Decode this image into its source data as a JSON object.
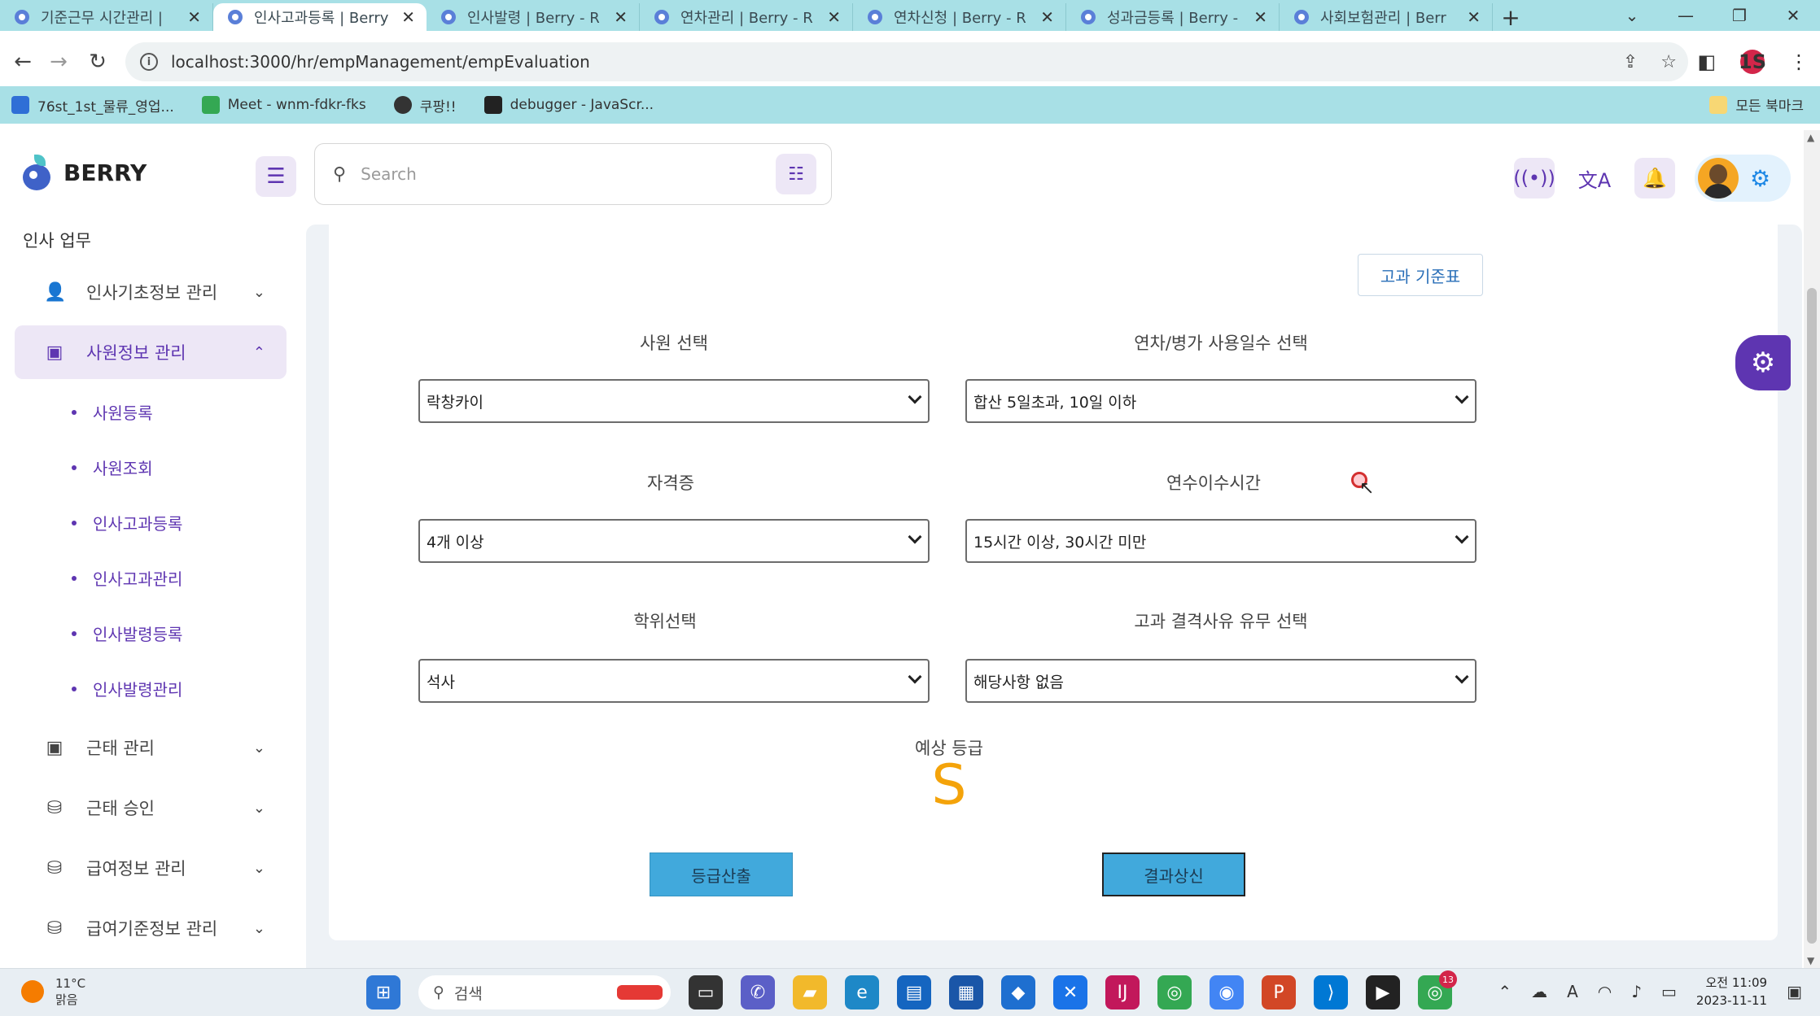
{
  "browser": {
    "tabs": [
      {
        "label": "기준근무 시간관리 |",
        "active": false
      },
      {
        "label": "인사고과등록 | Berry",
        "active": true
      },
      {
        "label": "인사발령 | Berry - R",
        "active": false
      },
      {
        "label": "연차관리 | Berry - R",
        "active": false
      },
      {
        "label": "연차신청 | Berry - R",
        "active": false
      },
      {
        "label": "성과금등록 | Berry -",
        "active": false
      },
      {
        "label": "사회보험관리 | Berr",
        "active": false
      }
    ],
    "url": "localhost:3000/hr/empManagement/empEvaluation",
    "profile_badge": "1S",
    "bookmarks": [
      {
        "label": "76st_1st_물류_영업...",
        "color": "#2f6fd6"
      },
      {
        "label": "Meet - wnm-fdkr-fks",
        "color": "#34a853"
      },
      {
        "label": "쿠팡!!",
        "color": "#333333"
      },
      {
        "label": "debugger - JavaScr...",
        "color": "#222222"
      }
    ],
    "all_bookmarks": "모든 북마크"
  },
  "app": {
    "logo_text": "BERRY",
    "search_placeholder": "Search"
  },
  "sidebar": {
    "heading": "인사 업무",
    "groups": [
      {
        "label": "인사기초정보 관리",
        "icon": "user-check-icon",
        "expanded": false
      },
      {
        "label": "사원정보 관리",
        "icon": "id-badge-icon",
        "expanded": true
      },
      {
        "label": "근태 관리",
        "icon": "id-badge-icon",
        "expanded": false
      },
      {
        "label": "근태 승인",
        "icon": "basket-icon",
        "expanded": false
      },
      {
        "label": "급여정보 관리",
        "icon": "basket-icon",
        "expanded": false
      },
      {
        "label": "급여기준정보 관리",
        "icon": "basket-icon",
        "expanded": false
      }
    ],
    "subitems": [
      "사원등록",
      "사원조회",
      "인사고과등록",
      "인사고과관리",
      "인사발령등록",
      "인사발령관리"
    ]
  },
  "form": {
    "criteria_button": "고과 기준표",
    "fields": [
      {
        "label": "사원 선택",
        "value": "락창카이"
      },
      {
        "label": "연차/병가 사용일수 선택",
        "value": "합산 5일초과, 10일 이하"
      },
      {
        "label": "자격증",
        "value": "4개 이상"
      },
      {
        "label": "연수이수시간",
        "value": "15시간 이상, 30시간 미만"
      },
      {
        "label": "학위선택",
        "value": "석사"
      },
      {
        "label": "고과 결격사유 유무 선택",
        "value": "해당사항 없음"
      }
    ],
    "expected_grade_label": "예상 등급",
    "expected_grade": "S",
    "calc_button": "등급산출",
    "submit_button": "결과상신"
  },
  "taskbar": {
    "weather_temp": "11°C",
    "weather_desc": "맑음",
    "search_label": "검색",
    "time": "오전 11:09",
    "date": "2023-11-11",
    "chrome_badge": "13"
  }
}
